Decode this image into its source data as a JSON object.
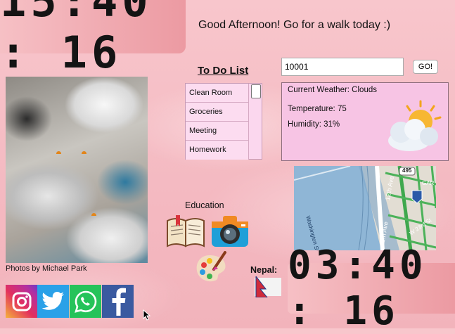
{
  "clock_main": {
    "time": "15:40 : 16"
  },
  "greeting": "Good Afternoon! Go for a walk today :)",
  "photo": {
    "credit": "Photos by Michael Park"
  },
  "todo": {
    "title": "To Do List",
    "items": [
      {
        "label": "Clean Room"
      },
      {
        "label": "Groceries"
      },
      {
        "label": "Meeting"
      },
      {
        "label": "Homework"
      }
    ]
  },
  "search": {
    "value": "10001",
    "button_label": "GO!"
  },
  "weather": {
    "current_label": "Current Weather: Clouds",
    "temperature_label": "Temperature: 75",
    "humidity_label": "Humidity: 31%",
    "icon": "partly-cloudy-icon"
  },
  "map": {
    "highway_badge": "495",
    "labels": [
      "Washington St",
      "12th Ave",
      "11th Ave",
      "W 23rd St",
      "GAR"
    ]
  },
  "education": {
    "label": "Education",
    "icons": [
      "book-icon",
      "camera-icon",
      "palette-icon"
    ]
  },
  "nepal": {
    "label": "Nepal:",
    "time": "03:40 : 16",
    "flag": "nepal-flag-icon"
  },
  "social": [
    "instagram-icon",
    "twitter-icon",
    "whatsapp-icon",
    "facebook-icon"
  ],
  "colors": {
    "background": "#f4b9c1",
    "clock_bg": "#ec9aa2",
    "weather_bg": "#f7c4e4",
    "todo_bg": "#fcdcf0"
  }
}
